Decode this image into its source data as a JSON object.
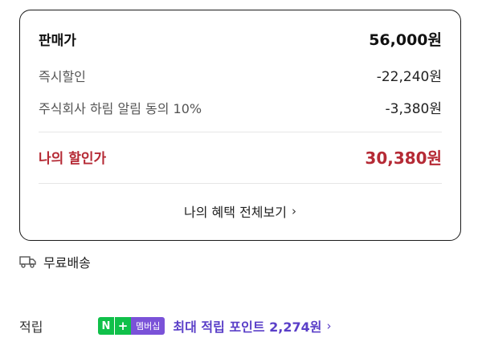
{
  "price": {
    "label": "판매가",
    "value": "56,000원"
  },
  "discounts": [
    {
      "label": "즉시할인",
      "value": "-22,240원"
    },
    {
      "label": "주식회사 하림 알림 동의 10%",
      "value": "-3,380원"
    }
  ],
  "final": {
    "label": "나의 할인가",
    "value": "30,380원"
  },
  "benefits_link": {
    "label": "나의 혜택 전체보기",
    "chevron": "›"
  },
  "shipping": {
    "icon": "truck-icon",
    "label": "무료배송"
  },
  "points": {
    "label": "적립",
    "badge": {
      "n": "N",
      "plus": "+",
      "membership": "멤버십"
    },
    "text": "최대 적립 포인트 2,274원",
    "chevron": "›"
  },
  "colors": {
    "discount_red": "#b52a35",
    "points_purple": "#5a3fc8",
    "naver_green": "#10c04a"
  }
}
